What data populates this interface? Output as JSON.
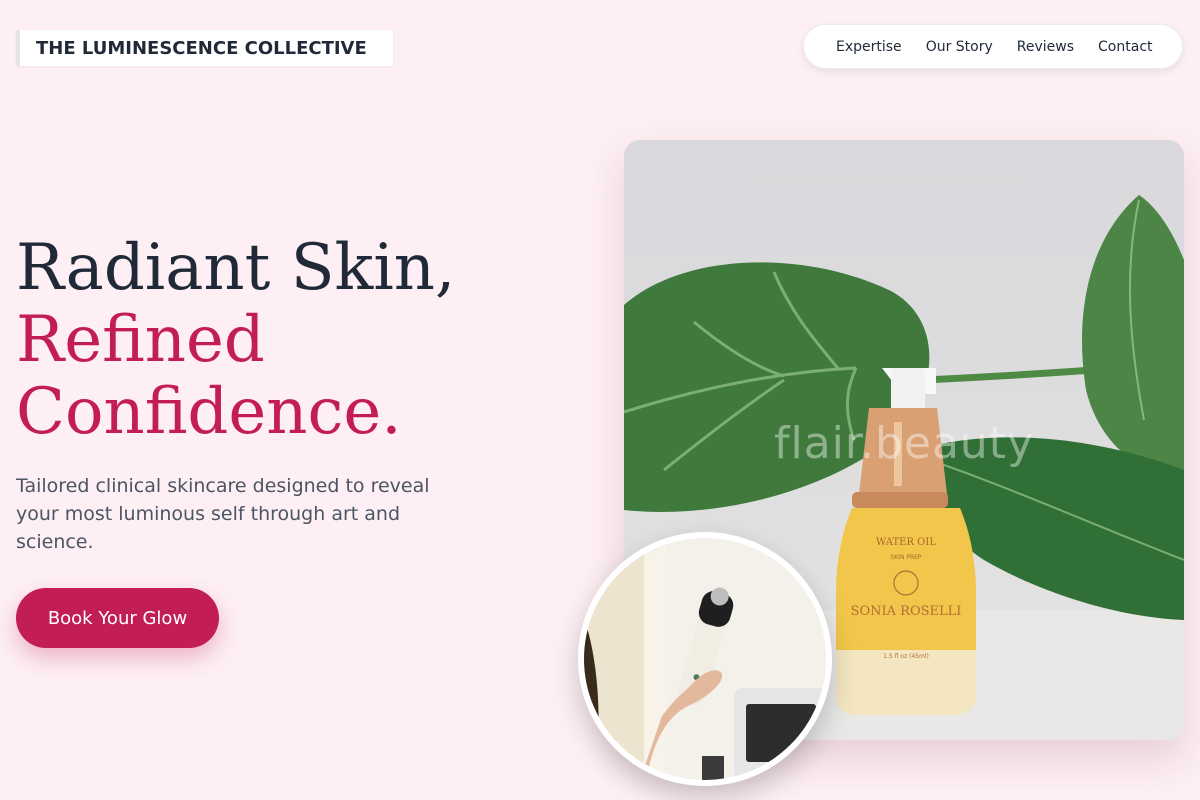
{
  "brand": {
    "name": "THE LUMINESCENCE COLLECTIVE"
  },
  "nav": {
    "items": [
      {
        "label": "Expertise"
      },
      {
        "label": "Our Story"
      },
      {
        "label": "Reviews"
      },
      {
        "label": "Contact"
      }
    ]
  },
  "hero": {
    "headline_line1": "Radiant Skin,",
    "headline_line2": "Refined",
    "headline_line3": "Confidence.",
    "subtitle": "Tailored clinical skincare designed to reveal your most luminous self through art and science.",
    "cta_label": "Book Your Glow"
  },
  "product_image": {
    "watermark": "flair.beauty",
    "bottle_label_line1": "WATER OIL",
    "bottle_label_line2": "SKIN PREP",
    "bottle_brand": "SONIA ROSELLI",
    "bottle_volume": "1.5 fl oz (45ml)"
  },
  "colors": {
    "background": "#fdeff3",
    "accent": "#c21d55",
    "heading": "#1f2937",
    "body_text": "#4b5563"
  }
}
